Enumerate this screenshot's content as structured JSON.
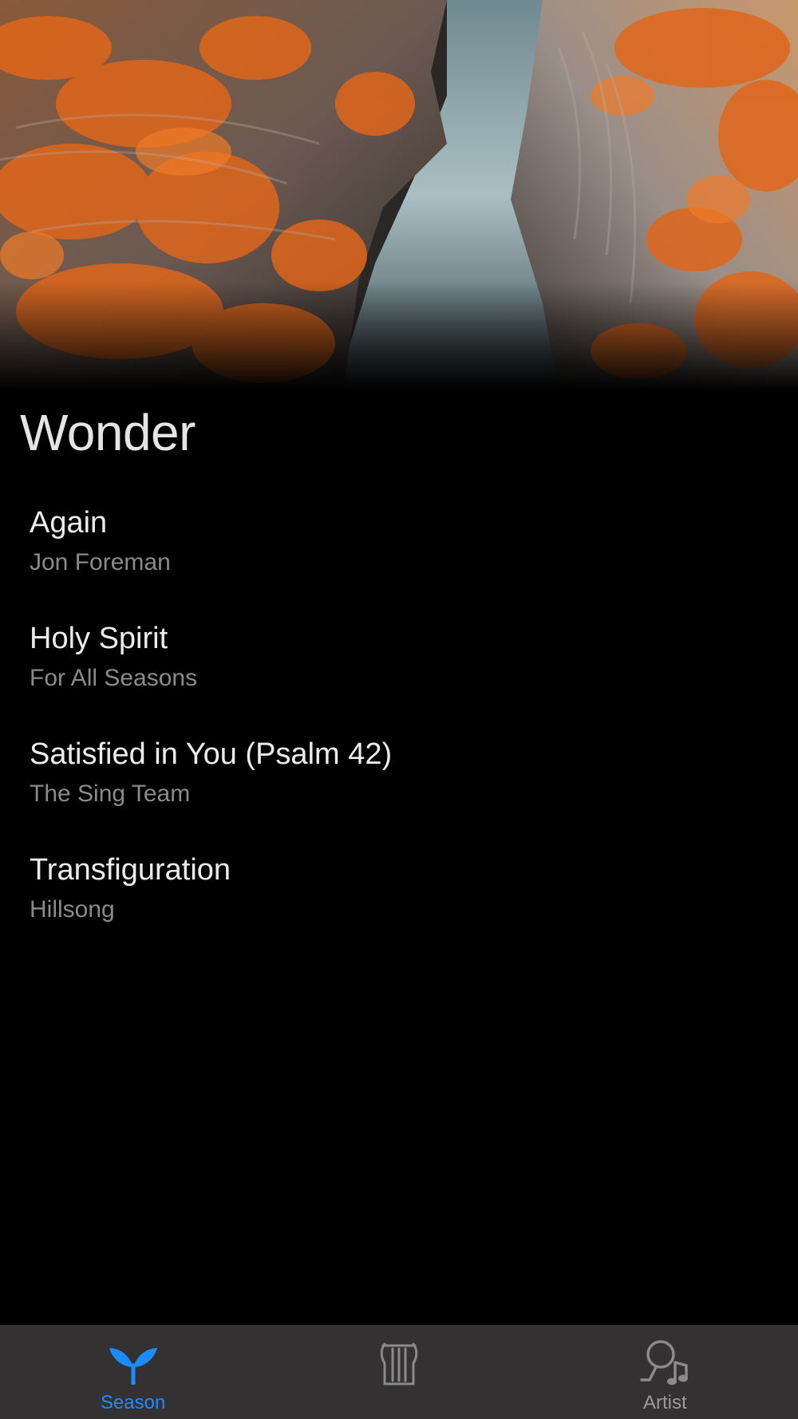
{
  "playlist": {
    "title": "Wonder"
  },
  "songs": [
    {
      "title": "Again",
      "artist": "Jon Foreman"
    },
    {
      "title": "Holy Spirit",
      "artist": "For All Seasons"
    },
    {
      "title": "Satisfied in You (Psalm 42)",
      "artist": "The Sing Team"
    },
    {
      "title": "Transfiguration",
      "artist": "Hillsong"
    }
  ],
  "tab_bar": {
    "tabs": [
      {
        "label": "Season",
        "icon": "sprout-icon",
        "active": true
      },
      {
        "label": "",
        "icon": "lyre-icon",
        "active": false
      },
      {
        "label": "Artist",
        "icon": "singer-icon",
        "active": false
      }
    ]
  },
  "colors": {
    "accent": "#1a8cff",
    "background": "#000000",
    "tab_bar": "#333131"
  }
}
